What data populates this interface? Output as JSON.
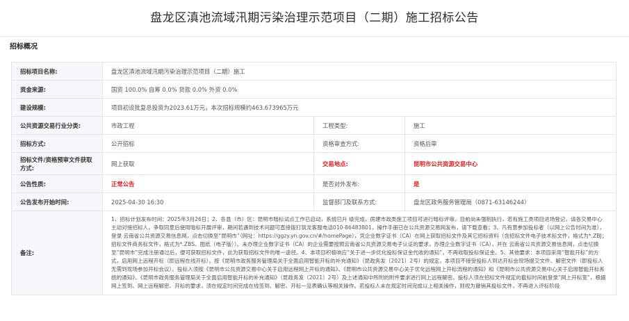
{
  "page_title": "盘龙区滇池流域汛期污染治理示范项目（二期）施工招标公告",
  "section_title": "招标概况",
  "rows": {
    "project_name": {
      "label": "招标项目名称:",
      "value": "盘龙区滇池流域汛期污染治理示范项目（二期）施工"
    },
    "funding": {
      "label": "资金来源:",
      "value": "国资 100.0% 自筹 0.0% 贷款 0.0% 外资 0.0%"
    },
    "scale": {
      "label": "建设规模:",
      "value": "项目初设批复总投资为2023.61万元，本次招标规模约463.673965万元"
    },
    "industry": {
      "label": "公共资源交易行业分类:",
      "value": "市政工程",
      "label2": "工程类型:",
      "value2": "施工"
    },
    "method": {
      "label": "招标方式:",
      "value": "公开招标",
      "label2": "资格审查方式:",
      "value2": "资格后审"
    },
    "docs": {
      "label": "招标文件/资格预审文件获取方式:",
      "value": "网上获取",
      "label2": "交易地点:",
      "value2": "昆明市公共资源交易中心"
    },
    "nature": {
      "label": "公告性质:",
      "value": "正常公告",
      "label2": "是否对外发布:",
      "value2": "是"
    },
    "publish": {
      "label": "公告发布开始时间:",
      "value": "2025-04-30 16:30",
      "label2": "监督部门及联系方式:",
      "value2": "盘龙区政务服务管理局（0871-63146244）"
    },
    "remark": {
      "label": "备注:",
      "value": "1、招标计划发布时间：2025年3月26日；2、各县（市）区：昆明市暗标试点工作已启动，系统已升 级完成，房建市政类施工项目可进行暗标评审。目前尚未强制执行，若有施工类项目进场登记，请各交易中心主动对接招标人，争取同意后使用暗标开展评审，期间若遇到技术问题可直接拨打筑龙客服电话010-86483801，操作手册已在公共资源交易网发布，请下载查看；3、凡有意参加投标者（以网上公告时间为准），登录 云南省公共资源交易信息网，点击切换至“昆明市”（网址：https://ggzy.yn.gov.cn/#/homePage），凭企业数字证书（CA）在网上获取招标文件及其它招标资料（含招标文件电子技术标文件，格式为*.ZBJ；招标文件商务标文件，格式为*.ZBS、图纸（电子版））。未办理企业数字证书（CA）的企业需要按照云南省公共资源交易电子认证的要求，办理企业数字证书（CA），并在 云南省公共资源交易信息网，点击切换至“昆明市”完成注册通过后，便可获取招标文件，此为获取招标文件的唯一途径。4、本项目积极响应“关于进一步优化投标保证金代收的通知”，不再收取投标保证金。5、其他要求：本项目采用“智能开标”的方式，启用网上远程开标（即远程在线开标）。按《昆明市政务服务管理局关于全面启用智能开标的补充通知》（昆政务发〔2021〕2号）的规定，本项目不接受投标人到达开标会现场提交文件、解密文件（即投标人无需到现场参加开标会议）。投标人须按《昆明市公共资源交易中心关于启用远程网上开标的通知》、《昆明市公共资源交易中心关于优化远程网上开标流程的通知》和《昆明市公共资源交易中心关于启用智能开标系统的通知》、《昆明市政务服务管理局关于全面启用智能开标的补充通知》（昆政务发〔2021〕2号）及上述通知中所附的附件要求进行网上远程解密。投标人须在招标文件规定的截标时间前登录“网上开标室”，根据网上签到、网上远程解密、开标的要求，须在规定时间完成在线签到、解密、开标一览表确认等相关操作。若投标人未在规定时间完成以上相关操作，则视为撤销其投标文件，不再进入评标阶段"
    }
  },
  "colors": {
    "accent_red": "#e02020",
    "label_bg": "#f5f7fa",
    "border": "#e4e4e4"
  }
}
